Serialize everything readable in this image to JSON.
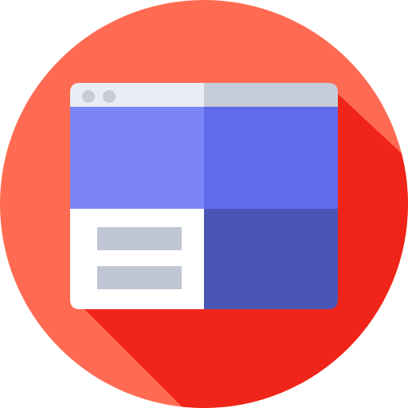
{
  "icon": {
    "name": "website-layout-icon",
    "colors": {
      "circle": "#ff6a52",
      "long_shadow": "#f02419",
      "title_bar_left": "#e9edf5",
      "title_bar_right": "#c7ccd9",
      "window_dots": "#c7ccd9",
      "panel_top_left": "#7b85f5",
      "panel_top_right": "#616aea",
      "panel_bottom_right": "#4a56b5",
      "panel_bottom_left": "#ffffff",
      "text_lines": "#c0c5d3"
    }
  }
}
